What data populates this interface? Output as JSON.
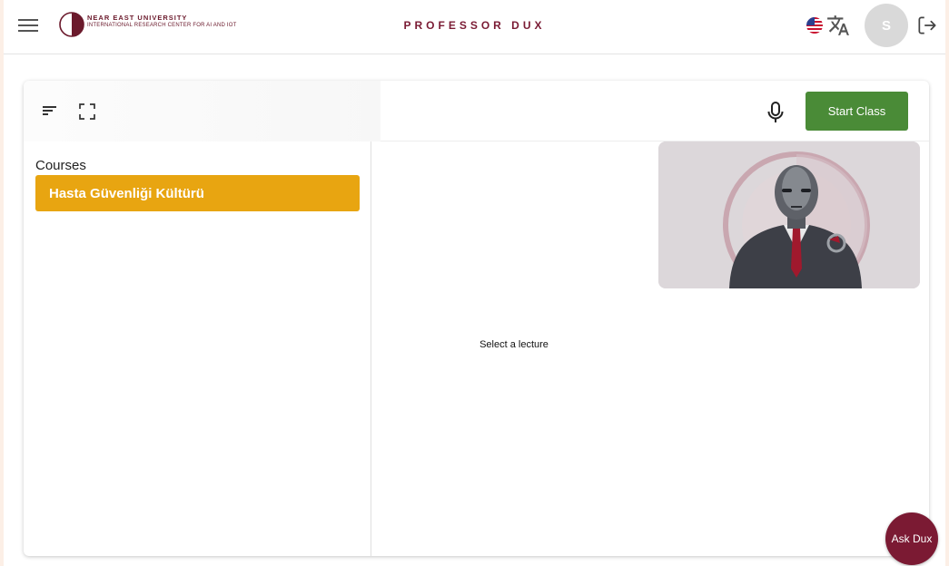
{
  "header": {
    "logo_line1": "NEAR EAST UNIVERSITY",
    "logo_line2": "INTERNATIONAL RESEARCH CENTER FOR AI AND IOT",
    "title": "PROFESSOR DUX",
    "avatar_initial": "S",
    "icons": [
      "menu-icon",
      "us-flag-icon",
      "translate-icon",
      "logout-icon"
    ]
  },
  "toolbar": {
    "start_button": "Start Class",
    "icons": [
      "sort-icon",
      "fullscreen-icon",
      "microphone-icon"
    ]
  },
  "sidebar": {
    "heading": "Courses",
    "courses": [
      {
        "label": "Hasta Güvenliği Kültürü",
        "selected": true
      }
    ]
  },
  "main": {
    "empty_message": "Select a lecture"
  },
  "fab": {
    "label": "Ask Dux"
  },
  "colors": {
    "brand": "#7a1b34",
    "start_button": "#4a8b37",
    "course_selected": "#e8a511",
    "page_background": "#fcefe6"
  }
}
